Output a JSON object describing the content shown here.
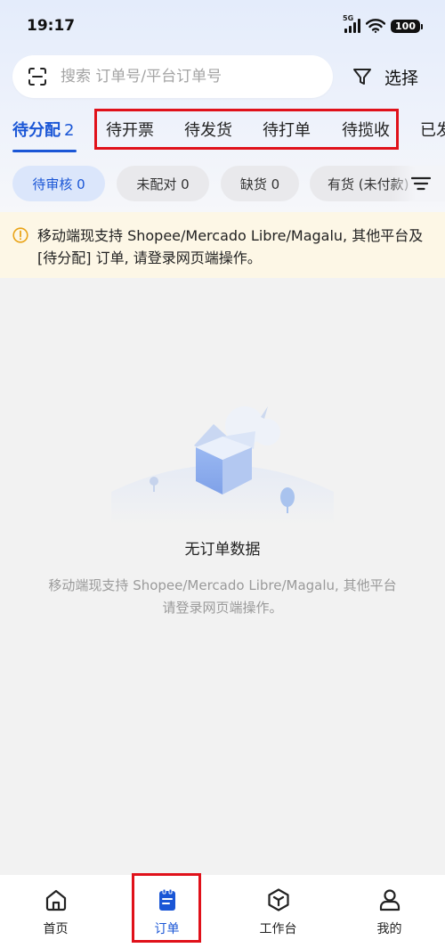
{
  "status_bar": {
    "time": "19:17",
    "network": "5G",
    "battery": "100"
  },
  "search": {
    "placeholder": "搜索 订单号/平台订单号",
    "select_label": "选择"
  },
  "tabs": [
    {
      "label": "待分配",
      "count": "2",
      "active": true
    },
    {
      "label": "待开票"
    },
    {
      "label": "待发货"
    },
    {
      "label": "待打单"
    },
    {
      "label": "待揽收"
    },
    {
      "label": "已发"
    }
  ],
  "chips": [
    {
      "label": "待审核 0",
      "active": true
    },
    {
      "label": "未配对 0"
    },
    {
      "label": "缺货 0"
    },
    {
      "label": "有货 (未付款)"
    }
  ],
  "notice": {
    "text": "移动端现支持 Shopee/Mercado Libre/Magalu, 其他平台及 [待分配] 订单, 请登录网页端操作。"
  },
  "empty_state": {
    "title": "无订单数据",
    "description": "移动端现支持 Shopee/Mercado Libre/Magalu, 其他平台请登录网页端操作。"
  },
  "bottom_nav": [
    {
      "label": "首页",
      "icon": "home-icon"
    },
    {
      "label": "订单",
      "icon": "order-icon",
      "active": true
    },
    {
      "label": "工作台",
      "icon": "workbench-icon"
    },
    {
      "label": "我的",
      "icon": "profile-icon"
    }
  ],
  "colors": {
    "accent": "#1a56d6",
    "highlight": "#e0111a",
    "notice_bg": "#fdf7e6"
  }
}
